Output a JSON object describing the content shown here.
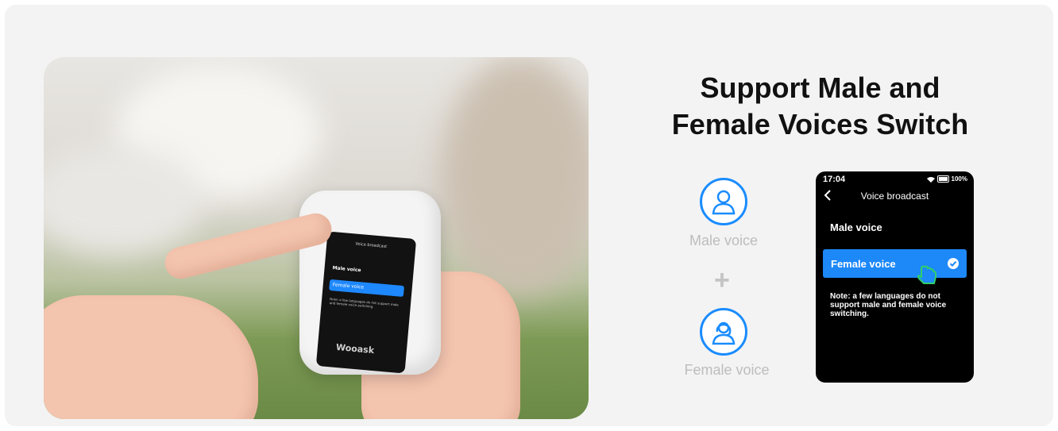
{
  "headline": {
    "line1": "Support Male and",
    "line2": "Female Voices Switch"
  },
  "options": {
    "male_label": "Male voice",
    "female_label": "Female voice",
    "plus": "+"
  },
  "device_photo": {
    "brand": "Wooask",
    "screen_title": "Voice broadcast",
    "male": "Male voice",
    "female": "Female voice",
    "note": "Note: a few languages do not support male and female voice switching."
  },
  "phone": {
    "time": "17:04",
    "battery": "100%",
    "title": "Voice broadcast",
    "male_item": "Male voice",
    "female_item": "Female voice",
    "note": "Note: a few languages do not support male and female voice switching."
  },
  "colors": {
    "accent": "#1d88f8",
    "icon_ring": "#1a8cff",
    "pointer": "#2fcf6a"
  }
}
